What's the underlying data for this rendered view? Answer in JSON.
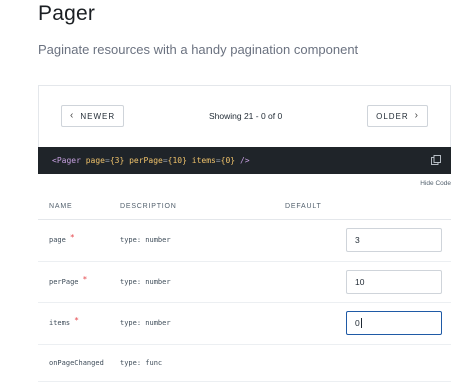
{
  "header": {
    "title": "Pager",
    "subtitle": "Paginate resources with a handy pagination component"
  },
  "pager": {
    "newer_label": "NEWER",
    "older_label": "OLDER",
    "status": "Showing 21 - 0 of 0"
  },
  "code": {
    "tag_open": "<Pager",
    "attrs": [
      {
        "name": "page",
        "value": "{3}"
      },
      {
        "name": "perPage",
        "value": "{10}"
      },
      {
        "name": "items",
        "value": "{0}"
      }
    ],
    "tag_close": "/>"
  },
  "hide_code_label": "Hide Code",
  "table": {
    "columns": [
      "NAME",
      "DESCRIPTION",
      "DEFAULT"
    ],
    "rows": [
      {
        "name": "page",
        "required": true,
        "description": "type: number",
        "value": "3"
      },
      {
        "name": "perPage",
        "required": true,
        "description": "type: number",
        "value": "10"
      },
      {
        "name": "items",
        "required": true,
        "description": "type: number",
        "value": "0"
      },
      {
        "name": "onPageChanged",
        "required": false,
        "description": "type: func",
        "value": ""
      }
    ],
    "required_marker": "*"
  },
  "colors": {
    "code_bg": "#1f2429",
    "focus_border": "#1f5aa6",
    "required": "#e5484d"
  }
}
